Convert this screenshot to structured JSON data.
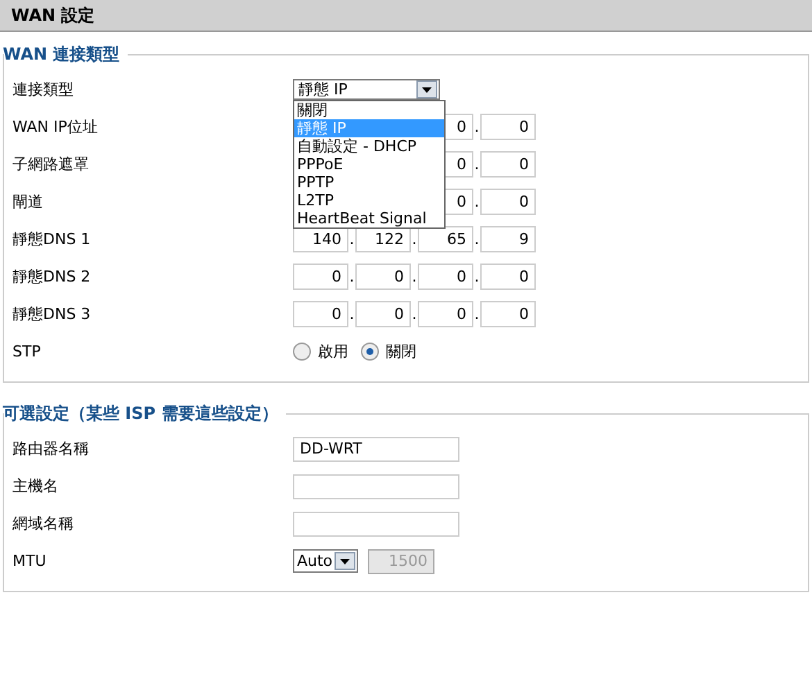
{
  "header": {
    "title": "WAN 設定"
  },
  "sections": [
    {
      "legend": "WAN 連接類型",
      "rows": [
        {
          "kind": "select",
          "label": "連接類型",
          "value": "靜態 IP",
          "expanded": true,
          "options": [
            {
              "label": "關閉",
              "selected": false
            },
            {
              "label": "靜態 IP",
              "selected": true
            },
            {
              "label": "自動設定 - DHCP",
              "selected": false
            },
            {
              "label": "PPPoE",
              "selected": false
            },
            {
              "label": "PPTP",
              "selected": false
            },
            {
              "label": "L2TP",
              "selected": false
            },
            {
              "label": "HeartBeat Signal",
              "selected": false
            }
          ]
        },
        {
          "kind": "ip",
          "label": "WAN IP位址",
          "octets": [
            "0",
            "0"
          ],
          "separators": [
            "."
          ]
        },
        {
          "kind": "ip",
          "label": "子網路遮罩",
          "octets": [
            "0",
            "0"
          ],
          "separators": [
            "."
          ]
        },
        {
          "kind": "ip",
          "label": "閘道",
          "octets": [
            "0",
            "0"
          ],
          "separators": [
            "."
          ]
        },
        {
          "kind": "ip",
          "label": "靜態DNS 1",
          "octets": [
            "140",
            "122",
            "65",
            "9"
          ],
          "separators": [
            ".",
            ".",
            "."
          ]
        },
        {
          "kind": "ip",
          "label": "靜態DNS 2",
          "octets": [
            "0",
            "0",
            "0",
            "0"
          ],
          "separators": [
            ".",
            ".",
            "."
          ]
        },
        {
          "kind": "ip",
          "label": "靜態DNS 3",
          "octets": [
            "0",
            "0",
            "0",
            "0"
          ],
          "separators": [
            ".",
            ".",
            "."
          ]
        },
        {
          "kind": "radio",
          "label": "STP",
          "options": [
            {
              "label": "啟用",
              "selected": false
            },
            {
              "label": "關閉",
              "selected": true
            }
          ]
        }
      ]
    },
    {
      "legend": "可選設定（某些 ISP 需要這些設定）",
      "rows": [
        {
          "kind": "text",
          "label": "路由器名稱",
          "value": "DD-WRT"
        },
        {
          "kind": "text",
          "label": "主機名"
        },
        {
          "kind": "text",
          "label": "網域名稱"
        },
        {
          "kind": "mtu",
          "label": "MTU",
          "value": "Auto",
          "number": "1500",
          "disabled": true
        }
      ]
    }
  ]
}
